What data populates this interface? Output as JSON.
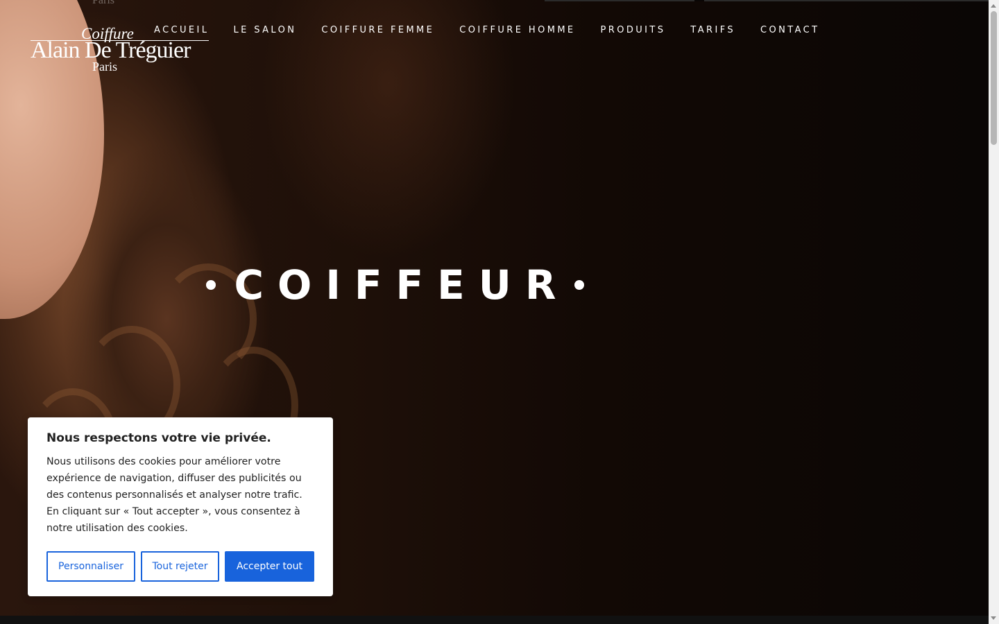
{
  "logo": {
    "ghost": "Paris",
    "line1": "Coiffure",
    "line2": "Alain De Tréguier",
    "line3": "Paris"
  },
  "nav": {
    "items": [
      {
        "label": "ACCUEIL",
        "active": true
      },
      {
        "label": "LE SALON"
      },
      {
        "label": "COIFFURE FEMME"
      },
      {
        "label": "COIFFURE HOMME"
      },
      {
        "label": "PRODUITS"
      },
      {
        "label": "TARIFS"
      },
      {
        "label": "CONTACT"
      }
    ]
  },
  "hero": {
    "title": "COIFFEUR"
  },
  "cookie": {
    "title": "Nous respectons votre vie privée.",
    "body": "Nous utilisons des cookies pour améliorer votre expérience de navigation, diffuser des publicités ou des contenus personnalisés et analyser notre trafic. En cliquant sur « Tout accepter », vous consentez à notre utilisation des cookies.",
    "customize_label": "Personnaliser",
    "reject_label": "Tout rejeter",
    "accept_label": "Accepter tout",
    "accent_color": "#1863dc"
  }
}
